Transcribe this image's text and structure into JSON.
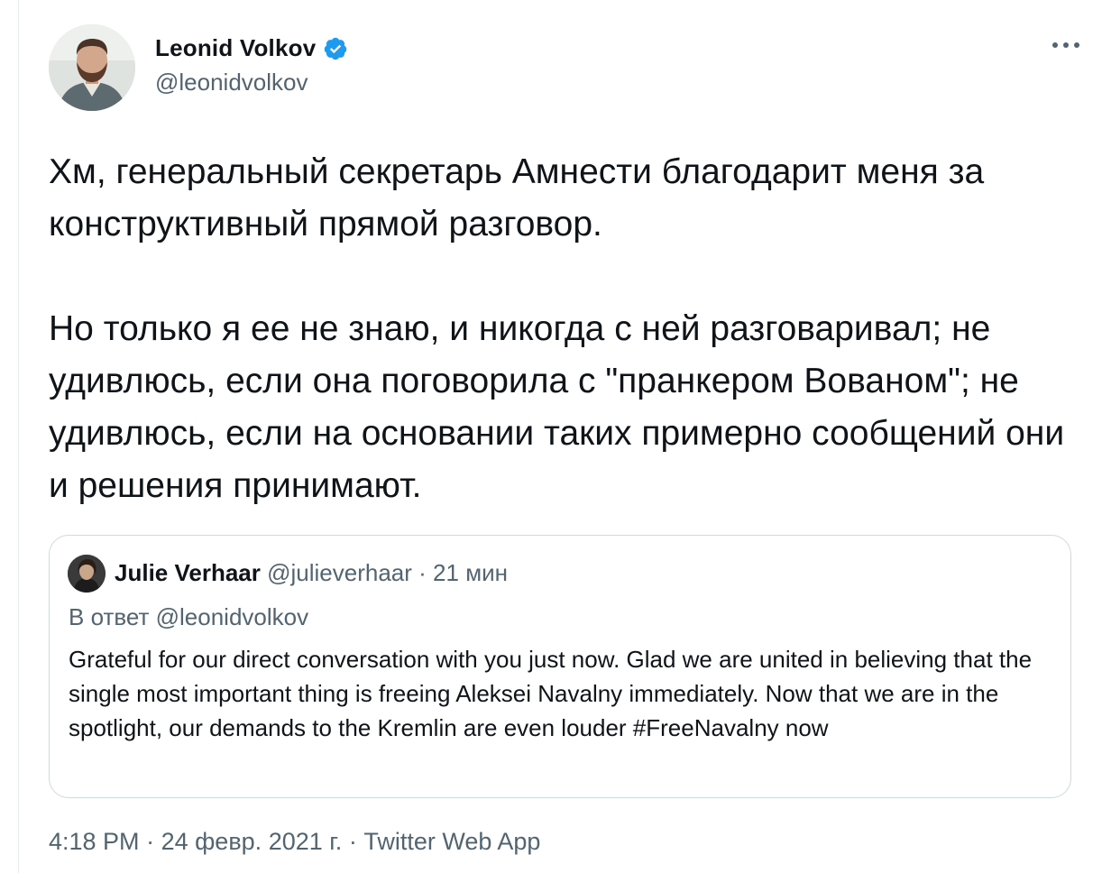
{
  "author": {
    "name": "Leonid Volkov",
    "handle": "@leonidvolkov",
    "verified_color": "#1d9bf0"
  },
  "tweet": {
    "text": "Хм, генеральный секретарь Амнести благодарит меня за конструктивный прямой разговор.\n\nНо только я ее не знаю, и никогда с ней разговаривал; не удивлюсь, если она поговорила с \"пранкером Вованом\"; не удивлюсь, если на основании таких примерно сообщений они и решения принимают."
  },
  "quote": {
    "name": "Julie Verhaar",
    "handle": "@julieverhaar",
    "separator": " · ",
    "time": "21 мин",
    "reply_to": "В ответ @leonidvolkov",
    "text": "Grateful for our direct conversation with you just now. Glad we are united in believing that the single most important thing is freeing Aleksei Navalny immediately. Now that we are in the spotlight, our demands to the Kremlin are even louder #FreeNavalny now"
  },
  "footer": {
    "time": "4:18 PM",
    "date": "24 февр. 2021 г.",
    "source": "Twitter Web App",
    "separator": " · "
  },
  "icons": {
    "more": "more-horizontal-icon",
    "verified": "verified-badge-icon"
  }
}
